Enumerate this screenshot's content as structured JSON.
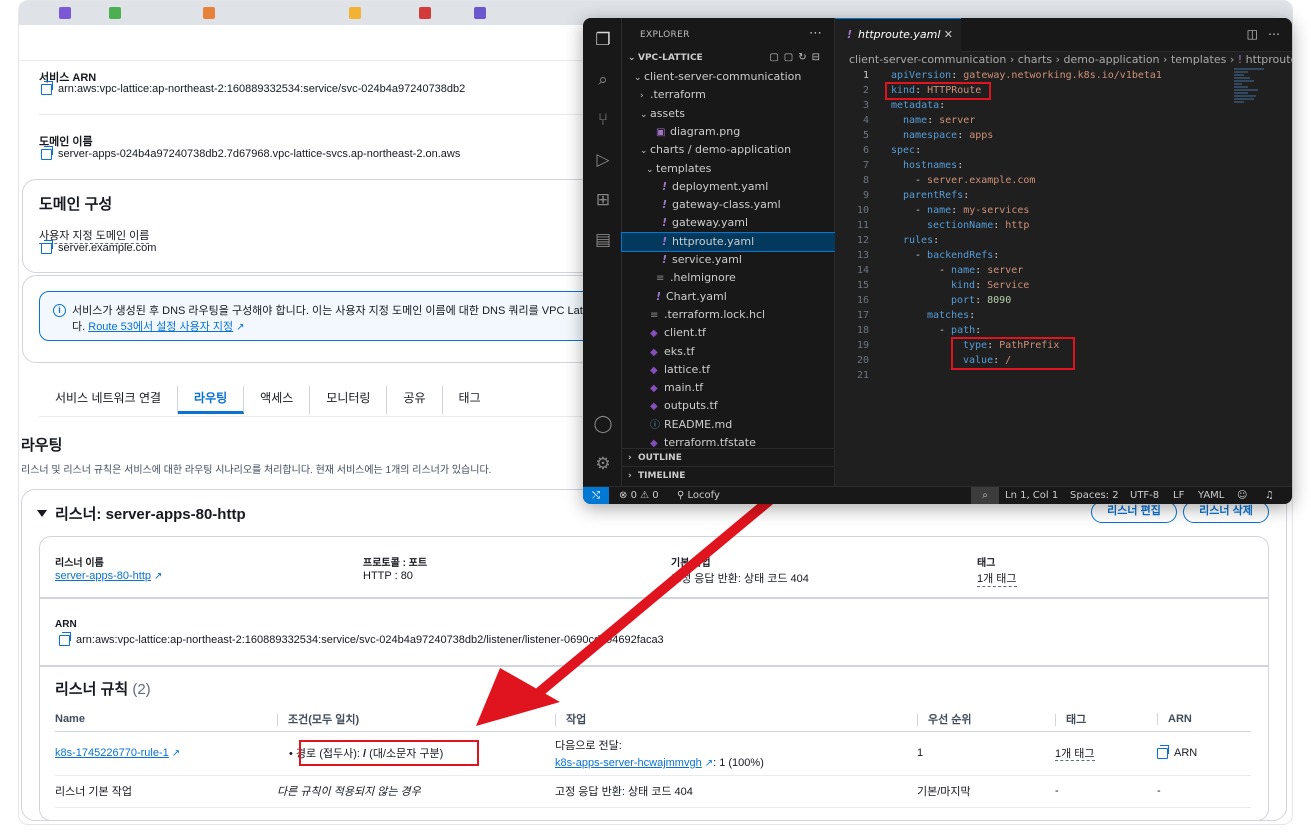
{
  "aws": {
    "service_arn": {
      "label": "서비스 ARN",
      "value": "arn:aws:vpc-lattice:ap-northeast-2:160889332534:service/svc-024b4a97240738db2"
    },
    "domain_name": {
      "label": "도메인 이름",
      "value": "server-apps-024b4a97240738db2.7d67968.vpc-lattice-svcs.ap-northeast-2.on.aws"
    },
    "domain_config": {
      "title": "도메인 구성",
      "custom_label": "사용자 지정 도메인 이름",
      "custom_value": "server.example.com"
    },
    "info_alert": {
      "text": "서비스가 생성된 후 DNS 라우팅을 구성해야 합니다. 이는 사용자 지정 도메인 이름에 대한 DNS 쿼리를 VPC Lattice",
      "text2": "다.",
      "link": "Route 53에서 설정 사용자 지정"
    },
    "tabs": [
      "서비스 네트워크 연결",
      "라우팅",
      "액세스",
      "모니터링",
      "공유",
      "태그"
    ],
    "routing": {
      "title": "라우팅",
      "description": "리스너 및 리스너 규칙은 서비스에 대한 라우팅 시나리오를 처리합니다. 현재 서비스에는 1개의 리스너가 있습니다."
    },
    "listener": {
      "title": "리스너: server-apps-80-http",
      "edit_button": "리스너 편집",
      "delete_button": "리스너 삭제",
      "name_label": "리스너 이름",
      "name_value": "server-apps-80-http",
      "protocol_label": "프로토콜 : 포트",
      "protocol_value": "HTTP : 80",
      "action_label": "기본 작업",
      "action_value": "고정 응답 반환: 상태 코드 404",
      "tag_label": "태그",
      "tag_value": "1개 태그",
      "arn_label": "ARN",
      "arn_value": "arn:aws:vpc-lattice:ap-northeast-2:160889332534:service/svc-024b4a97240738db2/listener/listener-0690cdb94692faca3"
    },
    "rules": {
      "title": "리스너 규칙",
      "count": "(2)",
      "columns": [
        "Name",
        "조건(모두 일치)",
        "작업",
        "우선 순위",
        "태그",
        "ARN"
      ],
      "rows": [
        {
          "name": "k8s-1745226770-rule-1",
          "condition_prefix": "경로 (접두사): ",
          "condition_path": "/",
          "condition_suffix": " (대/소문자 구분)",
          "action_line1": "다음으로 전달:",
          "action_target": "k8s-apps-server-hcwajmmvgh",
          "action_weight": ": 1 (100%)",
          "priority": "1",
          "tag": "1개 태그",
          "arn": "ARN"
        },
        {
          "name": "리스너 기본 작업",
          "condition": "다른 규칙이 적용되지 않는 경우",
          "action": "고정 응답 반환: 상태 코드 404",
          "priority": "기본/마지막",
          "tag": "-",
          "arn": "-"
        }
      ]
    }
  },
  "vscode": {
    "explorer_title": "EXPLORER",
    "root": "VPC-LATTICE",
    "tree": [
      {
        "label": "client-server-communication",
        "kind": "folder-open",
        "depth": 1
      },
      {
        "label": ".terraform",
        "kind": "folder",
        "depth": 2
      },
      {
        "label": "assets",
        "kind": "folder-open",
        "depth": 2
      },
      {
        "label": "diagram.png",
        "kind": "image",
        "depth": 3
      },
      {
        "label": "charts / demo-application",
        "kind": "folder-open",
        "depth": 2
      },
      {
        "label": "templates",
        "kind": "folder-open",
        "depth": 3
      },
      {
        "label": "deployment.yaml",
        "kind": "yaml",
        "depth": 4
      },
      {
        "label": "gateway-class.yaml",
        "kind": "yaml",
        "depth": 4
      },
      {
        "label": "gateway.yaml",
        "kind": "yaml",
        "depth": 4
      },
      {
        "label": "httproute.yaml",
        "kind": "yaml",
        "depth": 4,
        "selected": true
      },
      {
        "label": "service.yaml",
        "kind": "yaml",
        "depth": 4
      },
      {
        "label": ".helmignore",
        "kind": "text",
        "depth": 3
      },
      {
        "label": "Chart.yaml",
        "kind": "yaml",
        "depth": 3
      },
      {
        "label": ".terraform.lock.hcl",
        "kind": "text",
        "depth": 2
      },
      {
        "label": "client.tf",
        "kind": "tf",
        "depth": 2
      },
      {
        "label": "eks.tf",
        "kind": "tf",
        "depth": 2
      },
      {
        "label": "lattice.tf",
        "kind": "tf",
        "depth": 2
      },
      {
        "label": "main.tf",
        "kind": "tf",
        "depth": 2
      },
      {
        "label": "outputs.tf",
        "kind": "tf",
        "depth": 2
      },
      {
        "label": "README.md",
        "kind": "md",
        "depth": 2
      },
      {
        "label": "terraform.tfstate",
        "kind": "tf",
        "depth": 2
      }
    ],
    "outline": "OUTLINE",
    "timeline": "TIMELINE",
    "tab": "httproute.yaml",
    "breadcrumb": [
      "client-server-communication",
      "charts",
      "demo-application",
      "templates",
      "httproute..."
    ],
    "code": [
      {
        "indent": 0,
        "key": "apiVersion",
        "value": "gateway.networking.k8s.io/v1beta1"
      },
      {
        "indent": 0,
        "key": "kind",
        "value": "HTTPRoute"
      },
      {
        "indent": 0,
        "key": "metadata",
        "value": ""
      },
      {
        "indent": 1,
        "key": "name",
        "value": "server"
      },
      {
        "indent": 1,
        "key": "namespace",
        "value": "apps"
      },
      {
        "indent": 0,
        "key": "spec",
        "value": ""
      },
      {
        "indent": 1,
        "key": "hostnames",
        "value": ""
      },
      {
        "indent": 2,
        "dash": true,
        "value": "server.example.com"
      },
      {
        "indent": 1,
        "key": "parentRefs",
        "value": ""
      },
      {
        "indent": 2,
        "dash": true,
        "key": "name",
        "value": "my-services"
      },
      {
        "indent": 3,
        "key": "sectionName",
        "value": "http"
      },
      {
        "indent": 1,
        "key": "rules",
        "value": ""
      },
      {
        "indent": 2,
        "dash": true,
        "key": "backendRefs",
        "value": ""
      },
      {
        "indent": 4,
        "dash": true,
        "key": "name",
        "value": "server"
      },
      {
        "indent": 5,
        "key": "kind",
        "value": "Service"
      },
      {
        "indent": 5,
        "key": "port",
        "value": "8090",
        "num": true
      },
      {
        "indent": 3,
        "key": "matches",
        "value": ""
      },
      {
        "indent": 4,
        "dash": true,
        "key": "path",
        "value": ""
      },
      {
        "indent": 6,
        "key": "type",
        "value": "PathPrefix"
      },
      {
        "indent": 6,
        "key": "value",
        "value": "/"
      },
      {
        "indent": 0,
        "key": "",
        "value": ""
      }
    ],
    "status": {
      "errors": "0",
      "warnings": "0",
      "extension": "Locofy",
      "position": "Ln 1, Col 1",
      "spaces": "Spaces: 2",
      "encoding": "UTF-8",
      "eol": "LF",
      "language": "YAML"
    }
  },
  "colors": {
    "annotation_red": "#e0141e",
    "aws_blue": "#0972d3",
    "vscode_bg": "#1f1f1f"
  }
}
